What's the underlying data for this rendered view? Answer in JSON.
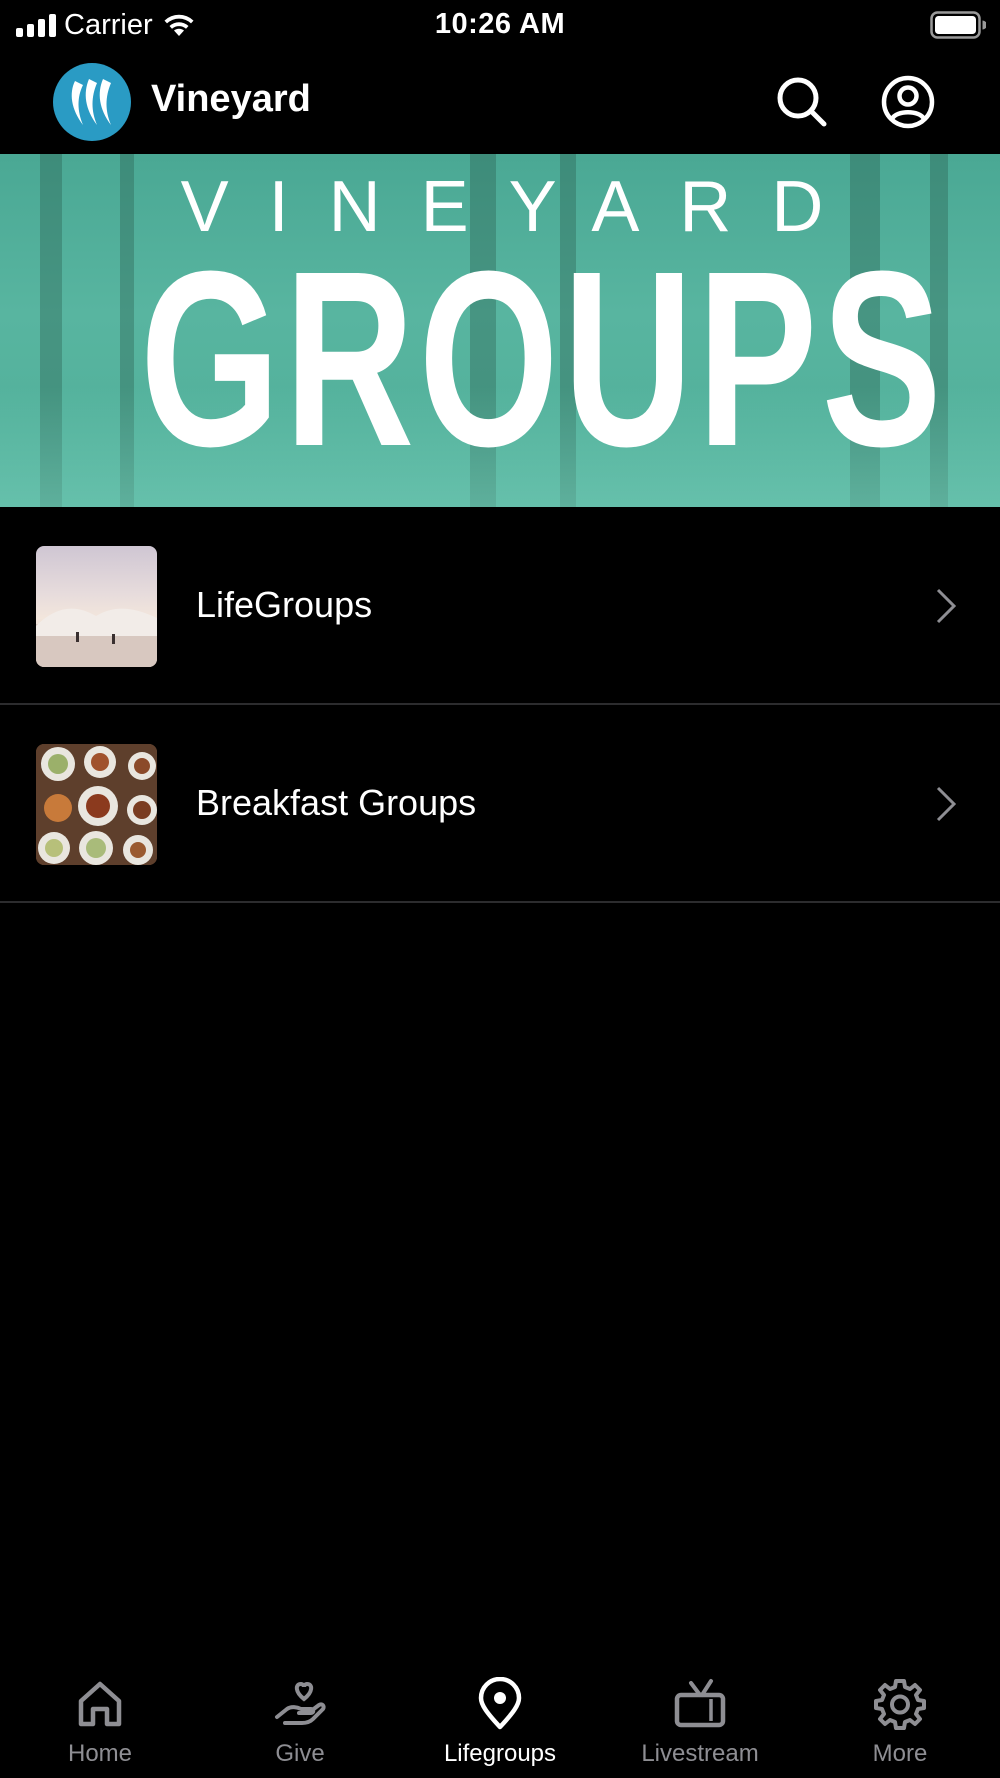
{
  "status_bar": {
    "carrier": "Carrier",
    "time": "10:26 AM"
  },
  "header": {
    "app_title": "Vineyard",
    "logo_color": "#2a9bc4"
  },
  "banner": {
    "subtitle": "VINEYARD",
    "title": "GROUPS",
    "color": "#4fae98"
  },
  "list": {
    "items": [
      {
        "label": "LifeGroups",
        "thumbnail": "beach-photo"
      },
      {
        "label": "Breakfast Groups",
        "thumbnail": "food-table-photo"
      }
    ]
  },
  "tab_bar": {
    "active_tab": "Lifegroups",
    "tabs": [
      {
        "label": "Home",
        "icon": "home-icon"
      },
      {
        "label": "Give",
        "icon": "give-icon"
      },
      {
        "label": "Lifegroups",
        "icon": "location-pin-icon"
      },
      {
        "label": "Livestream",
        "icon": "tv-icon"
      },
      {
        "label": "More",
        "icon": "gear-icon"
      }
    ]
  }
}
